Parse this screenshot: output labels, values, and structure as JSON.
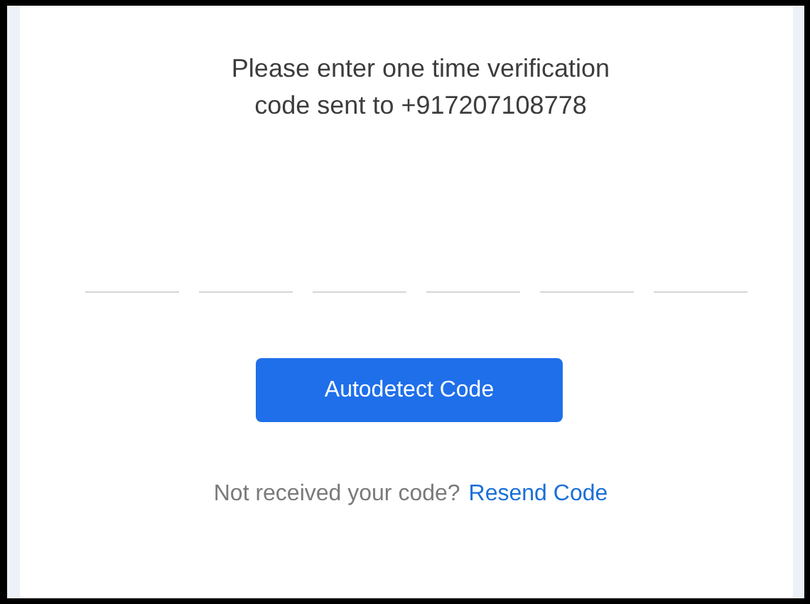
{
  "prompt": {
    "line_1": "Please enter one time verification",
    "line_2": "code sent to +917207108778"
  },
  "code_fields": [
    {
      "filled": false
    },
    {
      "filled": false
    },
    {
      "filled": false
    },
    {
      "filled": false
    },
    {
      "filled": false
    },
    {
      "filled": false
    }
  ],
  "autodetect_button": {
    "label": "Autodetect Code"
  },
  "resend": {
    "text": "Not received your code?",
    "link": "Resend Code"
  }
}
